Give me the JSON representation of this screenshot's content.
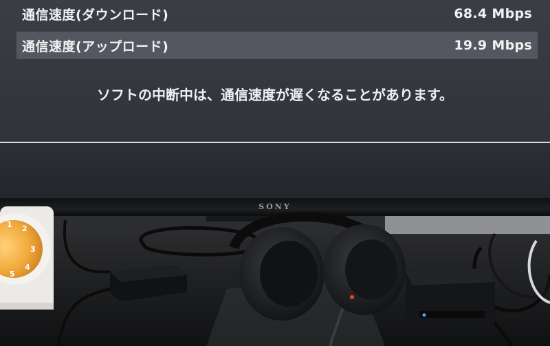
{
  "screen": {
    "rows": [
      {
        "label": "通信速度(ダウンロード)",
        "value": "68.4 Mbps",
        "highlighted": false
      },
      {
        "label": "通信速度(アップロード)",
        "value": "19.9 Mbps",
        "highlighted": true
      }
    ],
    "notice": "ソフトの中断中は、通信速度が遅くなることがあります。"
  },
  "tv": {
    "brand": "SONY"
  },
  "clock_face_digits": [
    "1",
    "2",
    "3",
    "4",
    "5"
  ],
  "colors": {
    "screen_bg": "#34373d",
    "highlight_row": "#54575f",
    "text": "#f1f2f4",
    "clock_face": "#f2a93b",
    "power_led": "#ff3a2a",
    "status_led": "#4aa8ff"
  }
}
